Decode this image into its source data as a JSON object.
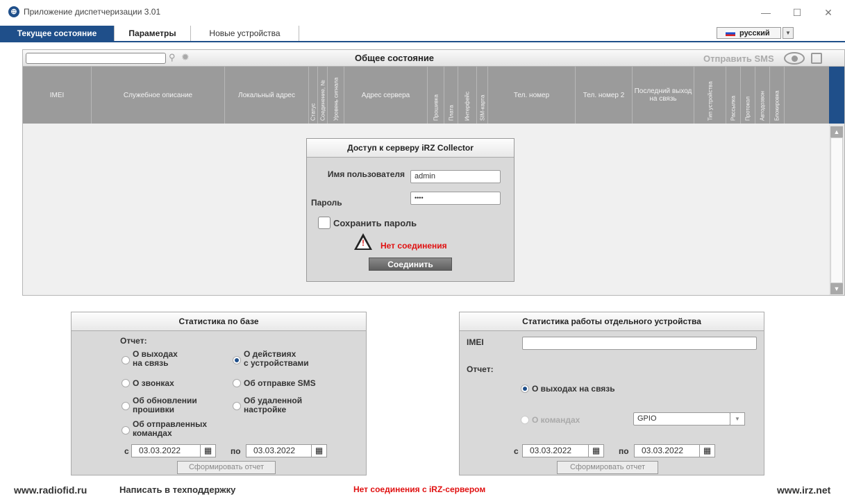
{
  "window": {
    "title": "Приложение диспетчеризации 3.01",
    "app_icon": "app-logo-icon"
  },
  "tabs": [
    {
      "label": "Текущее состояние",
      "active": true
    },
    {
      "label": "Параметры",
      "active": false
    },
    {
      "label": "Новые устройства",
      "active": false
    }
  ],
  "language": {
    "value": "русский"
  },
  "main_panel": {
    "title": "Общее состояние",
    "send_sms": "Отправить SMS",
    "search_value": ""
  },
  "columns": [
    "IMEI",
    "Служебное описание",
    "Локальный адрес",
    "Статус",
    "Соединение, №",
    "Уровень сигнала",
    "Адрес сервера",
    "Прошивка",
    "Плата",
    "Интерфейс",
    "SIM-карта",
    "Тел. номер",
    "Тел. номер 2",
    "Последний выход на связь",
    "Тип устройства",
    "Рассылка",
    "Протокол",
    "Автодозвон",
    "Блокировка"
  ],
  "login": {
    "title": "Доступ к серверу iRZ Collector",
    "username_label": "Имя пользователя",
    "username_value": "admin",
    "password_label": "Пароль",
    "password_value": "••••",
    "save_password_label": "Сохранить пароль",
    "status": "Нет соединения",
    "connect_label": "Соединить"
  },
  "db_stats": {
    "title": "Статистика по базе",
    "report_label": "Отчет:",
    "options": [
      {
        "label_1": "О выходах",
        "label_2": "на связь",
        "checked": false
      },
      {
        "label_1": "О действиях",
        "label_2": "с устройствами",
        "checked": true
      },
      {
        "label_1": "О звонках",
        "label_2": "",
        "checked": false
      },
      {
        "label_1": "Об отправке SMS",
        "label_2": "",
        "checked": false
      },
      {
        "label_1": "Об обновлении",
        "label_2": "прошивки",
        "checked": false
      },
      {
        "label_1": "Об удаленной",
        "label_2": "настройке",
        "checked": false
      },
      {
        "label_1": "Об отправленных",
        "label_2": "командах",
        "checked": false
      }
    ],
    "from_label": "с",
    "from_date": "03.03.2022",
    "to_label": "по",
    "to_date": "03.03.2022",
    "generate_label": "Сформировать отчет"
  },
  "device_stats": {
    "title": "Статистика работы отдельного устройства",
    "imei_label": "IMEI",
    "imei_value": "",
    "report_label": "Отчет:",
    "option_connections": "О выходах на связь",
    "option_commands": "О командах",
    "command_select": "GPIO",
    "from_label": "с",
    "from_date": "03.03.2022",
    "to_label": "по",
    "to_date": "03.03.2022",
    "generate_label": "Сформировать отчет"
  },
  "footer": {
    "left_link": "www.radiofid.ru",
    "support_link": "Написать в техподдержку",
    "status": "Нет соединения с iRZ-сервером",
    "right_link": "www.irz.net"
  },
  "colors": {
    "accent": "#1f4f8a",
    "header_grey": "#9b9b9b",
    "panel_bg": "#d9d9d9",
    "error_red": "#e01010"
  }
}
